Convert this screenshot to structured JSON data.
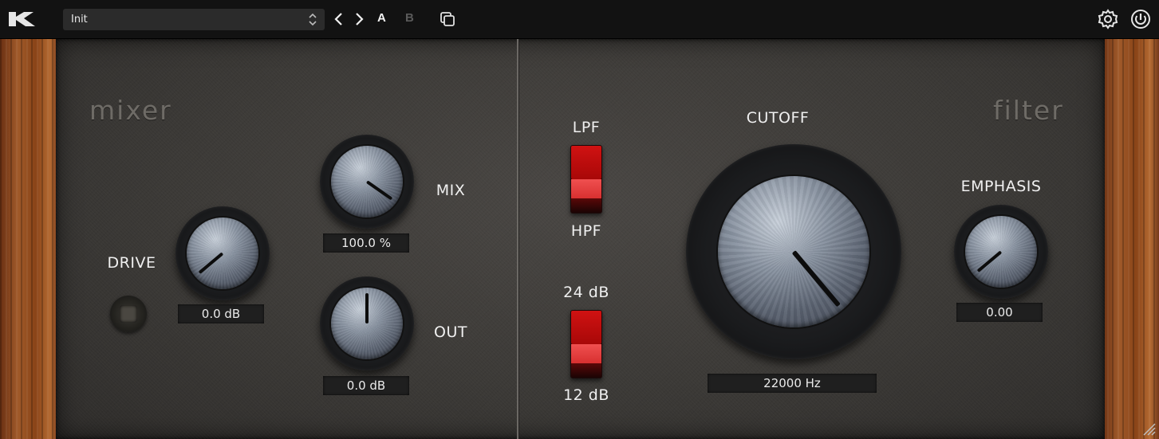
{
  "toolbar": {
    "preset_name": "Init",
    "ab_a": "A",
    "ab_b": "B"
  },
  "mixer": {
    "title": "mixer",
    "drive_label": "DRIVE",
    "drive_value": "0.0 dB",
    "mix_label": "MIX",
    "mix_value": "100.0 %",
    "out_label": "OUT",
    "out_value": "0.0 dB"
  },
  "filter": {
    "title": "filter",
    "lpf_label": "LPF",
    "hpf_label": "HPF",
    "slope_24_label": "24 dB",
    "slope_12_label": "12 dB",
    "cutoff_label": "CUTOFF",
    "cutoff_value": "22000 Hz",
    "emphasis_label": "EMPHASIS",
    "emphasis_value": "0.00"
  },
  "colors": {
    "accent_red": "#c81010",
    "panel": "#3c3a37",
    "wood": "#8a4418"
  }
}
